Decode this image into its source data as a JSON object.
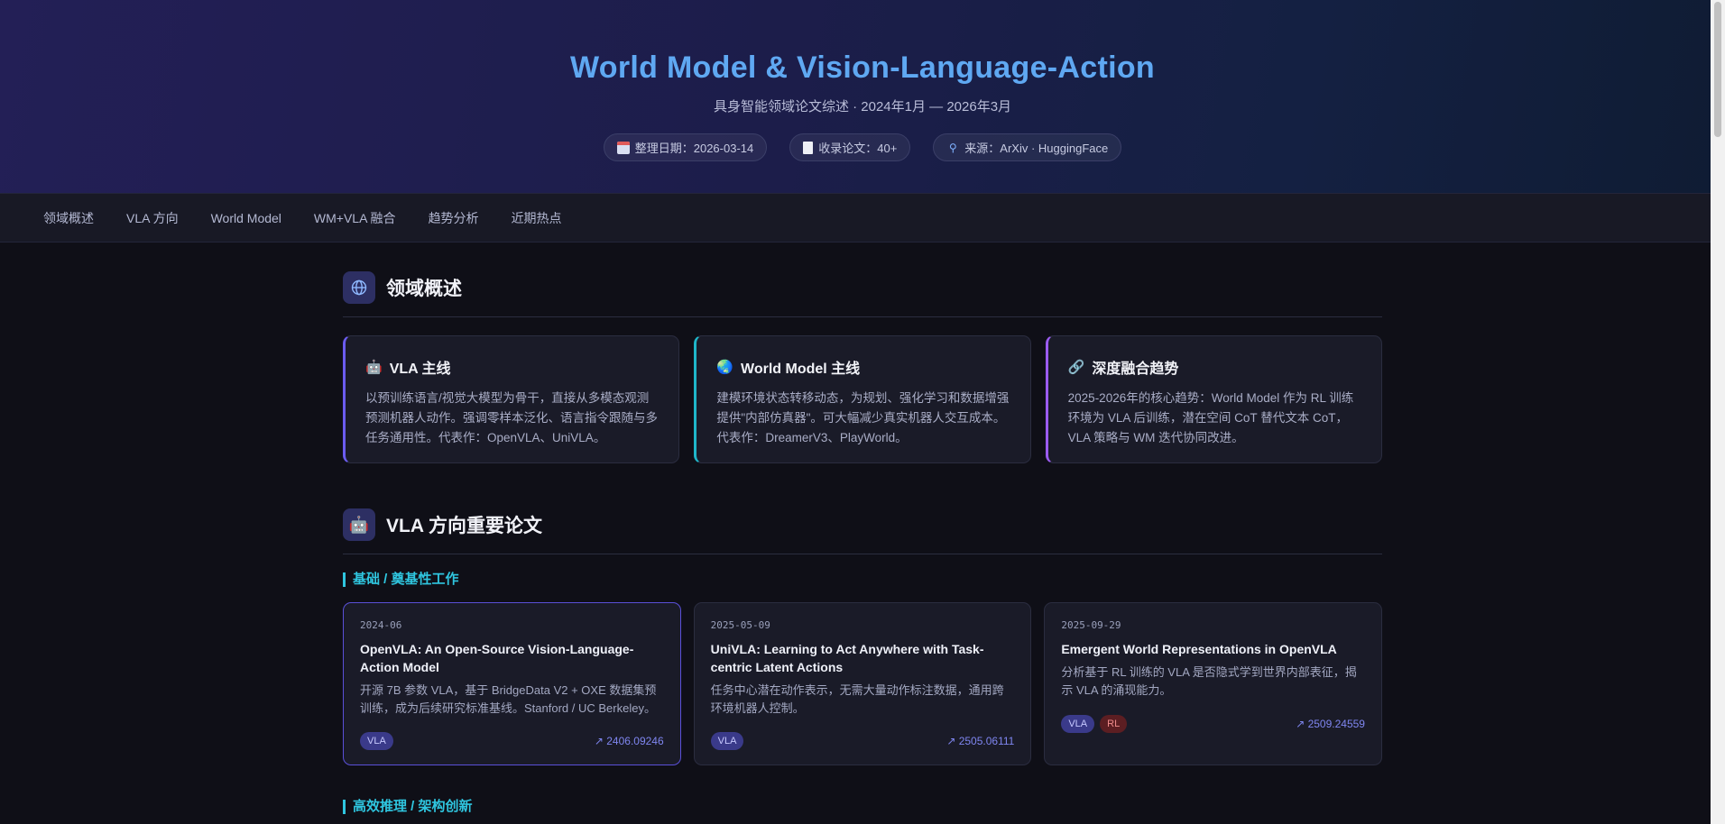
{
  "hero": {
    "title": "World Model & Vision-Language-Action",
    "subtitle": "具身智能领域论文综述 · 2024年1月 — 2026年3月",
    "badges": [
      {
        "icon": "calendar-icon",
        "text": "整理日期：2026-03-14"
      },
      {
        "icon": "document-icon",
        "text": "收录论文：40+"
      },
      {
        "icon": "magnifier-icon",
        "text": "来源：ArXiv · HuggingFace"
      }
    ]
  },
  "nav": {
    "items": [
      "领域概述",
      "VLA 方向",
      "World Model",
      "WM+VLA 融合",
      "趋势分析",
      "近期热点"
    ]
  },
  "overview": {
    "icon": "globe-icon",
    "title": "领域概述",
    "cards": [
      {
        "icon": "robot-icon",
        "title": "VLA 主线",
        "desc": "以预训练语言/视觉大模型为骨干，直接从多模态观测预测机器人动作。强调零样本泛化、语言指令跟随与多任务通用性。代表作：OpenVLA、UniVLA。"
      },
      {
        "icon": "earth-icon",
        "title": "World Model 主线",
        "desc": "建模环境状态转移动态，为规划、强化学习和数据增强提供\"内部仿真器\"。可大幅减少真实机器人交互成本。代表作：DreamerV3、PlayWorld。"
      },
      {
        "icon": "link-icon",
        "title": "深度融合趋势",
        "desc": "2025-2026年的核心趋势：World Model 作为 RL 训练环境为 VLA 后训练，潜在空间 CoT 替代文本 CoT，VLA 策略与 WM 迭代协同改进。"
      }
    ]
  },
  "vla": {
    "icon": "robot-icon",
    "title": "VLA 方向重要论文",
    "sub1": "基础 / 奠基性工作",
    "sub2": "高效推理 / 架构创新",
    "papers": [
      {
        "date": "2024-06",
        "title": "OpenVLA: An Open-Source Vision-Language-Action Model",
        "desc": "开源 7B 参数 VLA，基于 BridgeData V2 + OXE 数据集预训练，成为后续研究标准基线。Stanford / UC Berkeley。",
        "tags": [
          "VLA"
        ],
        "link": "↗ 2406.09246"
      },
      {
        "date": "2025-05-09",
        "title": "UniVLA: Learning to Act Anywhere with Task-centric Latent Actions",
        "desc": "任务中心潜在动作表示，无需大量动作标注数据，通用跨环境机器人控制。",
        "tags": [
          "VLA"
        ],
        "link": "↗ 2505.06111"
      },
      {
        "date": "2025-09-29",
        "title": "Emergent World Representations in OpenVLA",
        "desc": "分析基于 RL 训练的 VLA 是否隐式学到世界内部表征，揭示 VLA 的涌现能力。",
        "tags": [
          "VLA",
          "RL"
        ],
        "link": "↗ 2509.24559"
      }
    ]
  }
}
